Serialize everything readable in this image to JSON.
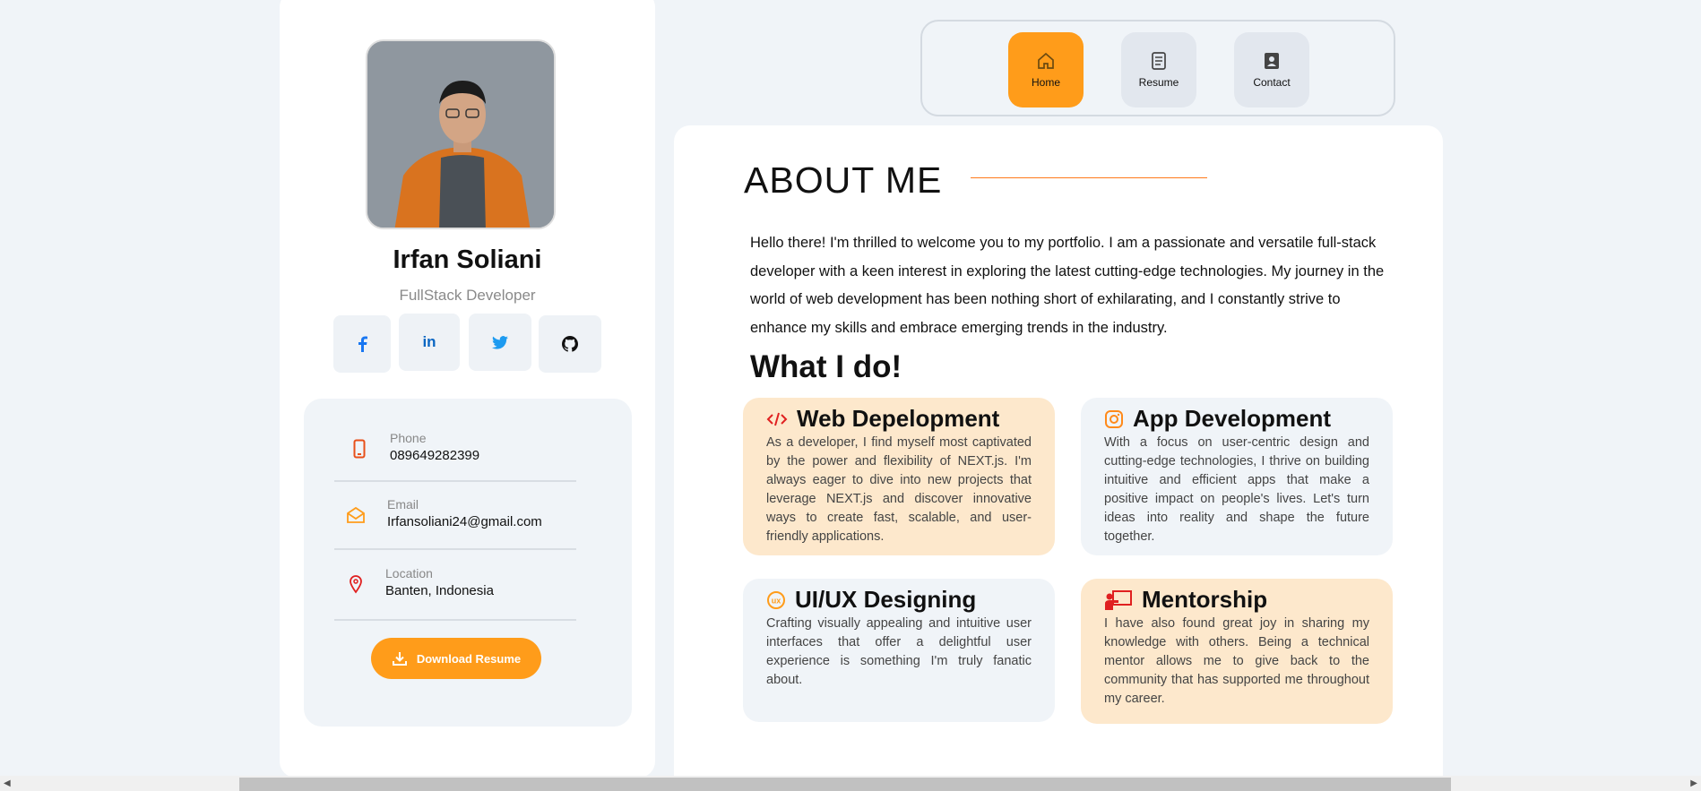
{
  "profile": {
    "name": "Irfan Soliani",
    "role": "FullStack Developer",
    "socials": [
      {
        "icon": "facebook-icon"
      },
      {
        "icon": "linkedin-icon"
      },
      {
        "icon": "twitter-icon"
      },
      {
        "icon": "github-icon"
      }
    ],
    "contacts": [
      {
        "label": "Phone",
        "value": "089649282399",
        "icon": "phone-icon"
      },
      {
        "label": "Email",
        "value": "Irfansoliani24@gmail.com",
        "icon": "mail-icon"
      },
      {
        "label": "Location",
        "value": "Banten, Indonesia",
        "icon": "location-pin-icon"
      }
    ],
    "download_label": "Download Resume"
  },
  "nav": {
    "items": [
      {
        "label": "Home",
        "icon": "home-icon",
        "active": true
      },
      {
        "label": "Resume",
        "icon": "document-icon",
        "active": false
      },
      {
        "label": "Contact",
        "icon": "contact-book-icon",
        "active": false
      }
    ]
  },
  "about": {
    "title": "ABOUT ME",
    "text": "Hello there! I'm thrilled to welcome you to my portfolio. I am a passionate and versatile full-stack developer with a keen interest in exploring the latest cutting-edge technologies. My journey in the world of web development has been nothing short of exhilarating, and I constantly strive to enhance my skills and embrace emerging trends in the industry.",
    "whatido_title": "What I do!",
    "services": [
      {
        "title": "Web Depelopment",
        "icon": "code-icon",
        "description": "As a developer, I find myself most captivated by the power and flexibility of NEXT.js. I'm always eager to dive into new projects that leverage NEXT.js and discover innovative ways to create fast, scalable, and user-friendly applications."
      },
      {
        "title": "App Development",
        "icon": "instagram-icon",
        "description": "With a focus on user-centric design and cutting-edge technologies, I thrive on building intuitive and efficient apps that make a positive impact on people's lives. Let's turn ideas into reality and shape the future together."
      },
      {
        "title": "UI/UX Designing",
        "icon": "ux-icon",
        "description": "Crafting visually appealing and intuitive user interfaces that offer a delightful user experience is something I'm truly fanatic about."
      },
      {
        "title": "Mentorship",
        "icon": "teacher-icon",
        "description": "I have also found great joy in sharing my knowledge with others. Being a technical mentor allows me to give back to the community that has supported me throughout my career."
      }
    ]
  },
  "colors": {
    "accent": "#ff9c1a",
    "service_orange": "#fde8cc",
    "service_blue": "#f0f4f8"
  }
}
